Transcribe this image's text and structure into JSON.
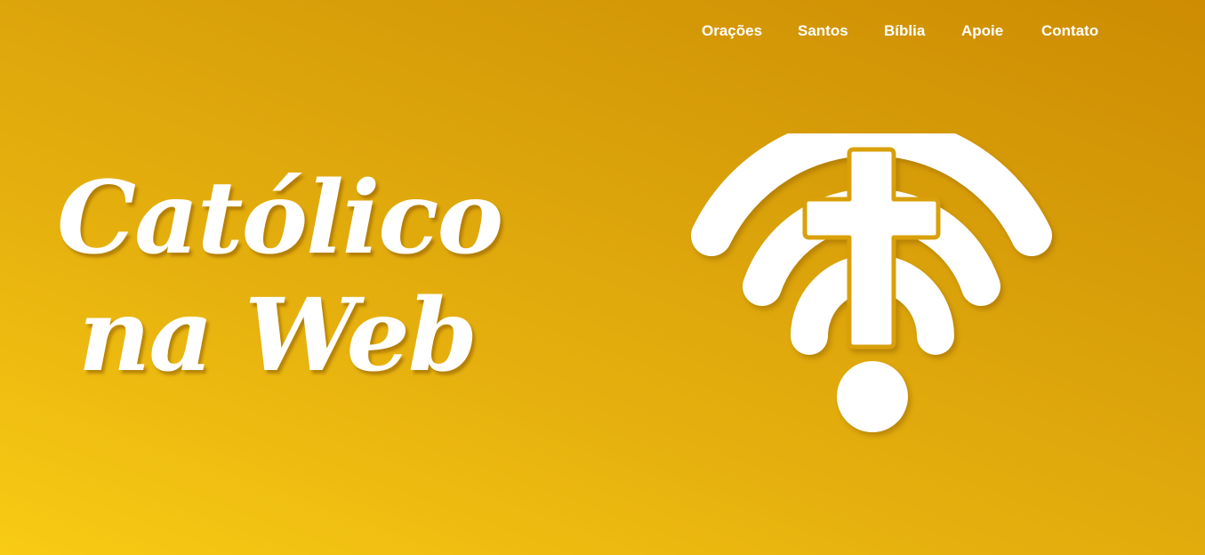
{
  "nav": {
    "items": [
      "Orações",
      "Santos",
      "Bíblia",
      "Apoie",
      "Contato"
    ]
  },
  "hero": {
    "title_line1": "Católico",
    "title_line2": "na Web"
  },
  "logo": {
    "icon": "wifi-cross-icon",
    "color": "#ffffff",
    "cross_outline_color": "#d9a00a"
  },
  "colors": {
    "background_light": "#f8cb14",
    "background_dark": "#cd8c02",
    "text": "#ffffff"
  }
}
